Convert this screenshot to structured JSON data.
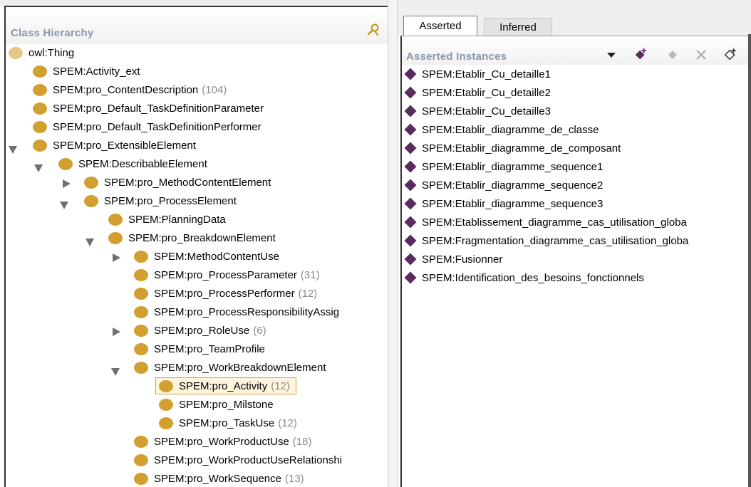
{
  "class_hierarchy": {
    "title": "Class Hierarchy",
    "find_icon": "find-person-icon",
    "nodes": [
      {
        "label": "owl:Thing",
        "count": ""
      },
      {
        "label": "SPEM:Activity_ext",
        "count": ""
      },
      {
        "label": "SPEM:pro_ContentDescription",
        "count": "(104)"
      },
      {
        "label": "SPEM:pro_Default_TaskDefinitionParameter",
        "count": ""
      },
      {
        "label": "SPEM:pro_Default_TaskDefinitionPerformer",
        "count": ""
      },
      {
        "label": "SPEM:pro_ExtensibleElement",
        "count": ""
      },
      {
        "label": "SPEM:DescribableElement",
        "count": ""
      },
      {
        "label": "SPEM:pro_MethodContentElement",
        "count": ""
      },
      {
        "label": "SPEM:pro_ProcessElement",
        "count": ""
      },
      {
        "label": "SPEM:PlanningData",
        "count": ""
      },
      {
        "label": "SPEM:pro_BreakdownElement",
        "count": ""
      },
      {
        "label": "SPEM:MethodContentUse",
        "count": ""
      },
      {
        "label": "SPEM:pro_ProcessParameter",
        "count": "(31)"
      },
      {
        "label": "SPEM:pro_ProcessPerformer",
        "count": "(12)"
      },
      {
        "label": "SPEM:pro_ProcessResponsibilityAssig",
        "count": ""
      },
      {
        "label": "SPEM:pro_RoleUse",
        "count": "(6)"
      },
      {
        "label": "SPEM:pro_TeamProfile",
        "count": ""
      },
      {
        "label": "SPEM:pro_WorkBreakdownElement",
        "count": ""
      },
      {
        "label": "SPEM:pro_Activity",
        "count": "(12)"
      },
      {
        "label": "SPEM:pro_Milstone",
        "count": ""
      },
      {
        "label": "SPEM:pro_TaskUse",
        "count": "(12)"
      },
      {
        "label": "SPEM:pro_WorkProductUse",
        "count": "(18)"
      },
      {
        "label": "SPEM:pro_WorkProductUseRelationshi",
        "count": ""
      },
      {
        "label": "SPEM:pro_WorkSequence",
        "count": "(13)"
      }
    ],
    "selected": "SPEM:pro_Activity"
  },
  "tabs": {
    "asserted": "Asserted",
    "inferred": "Inferred",
    "active": "Asserted"
  },
  "instances_panel": {
    "title": "Asserted Instances",
    "toolbar_icons": [
      "dropdown-arrow-icon",
      "add-instance-icon",
      "duplicate-instance-icon",
      "delete-instance-icon",
      "rename-instance-icon"
    ],
    "items": [
      "SPEM:Etablir_Cu_detaille1",
      "SPEM:Etablir_Cu_detaille2",
      "SPEM:Etablir_Cu_detaille3",
      "SPEM:Etablir_diagramme_de_classe",
      "SPEM:Etablir_diagramme_de_composant",
      "SPEM:Etablir_diagramme_sequence1",
      "SPEM:Etablir_diagramme_sequence2",
      "SPEM:Etablir_diagramme_sequence3",
      "SPEM:Etablissement_diagramme_cas_utilisation_globa",
      "SPEM:Fragmentation_diagramme_cas_utilisation_globa",
      "SPEM:Fusionner",
      "SPEM:Identification_des_besoins_fonctionnels"
    ]
  },
  "colors": {
    "class_icon": "#d1a030",
    "thing_icon": "#e6c786",
    "instance_icon": "#5b2a5e",
    "panel_title": "#8a97ab",
    "selection_bg": "#fff5df",
    "selection_border": "#c9a04a"
  }
}
